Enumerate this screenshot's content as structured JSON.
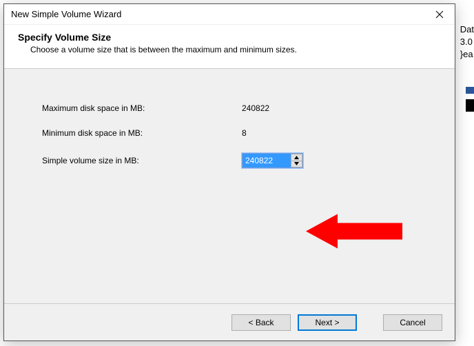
{
  "bg": {
    "line1": "Dat",
    "line2": "3.0",
    "line3": "}ea"
  },
  "titlebar": {
    "title": "New Simple Volume Wizard"
  },
  "header": {
    "title": "Specify Volume Size",
    "subtitle": "Choose a volume size that is between the maximum and minimum sizes."
  },
  "fields": {
    "max_label": "Maximum disk space in MB:",
    "max_value": "240822",
    "min_label": "Minimum disk space in MB:",
    "min_value": "8",
    "size_label": "Simple volume size in MB:",
    "size_value": "240822"
  },
  "buttons": {
    "back": "< Back",
    "next": "Next >",
    "cancel": "Cancel"
  }
}
